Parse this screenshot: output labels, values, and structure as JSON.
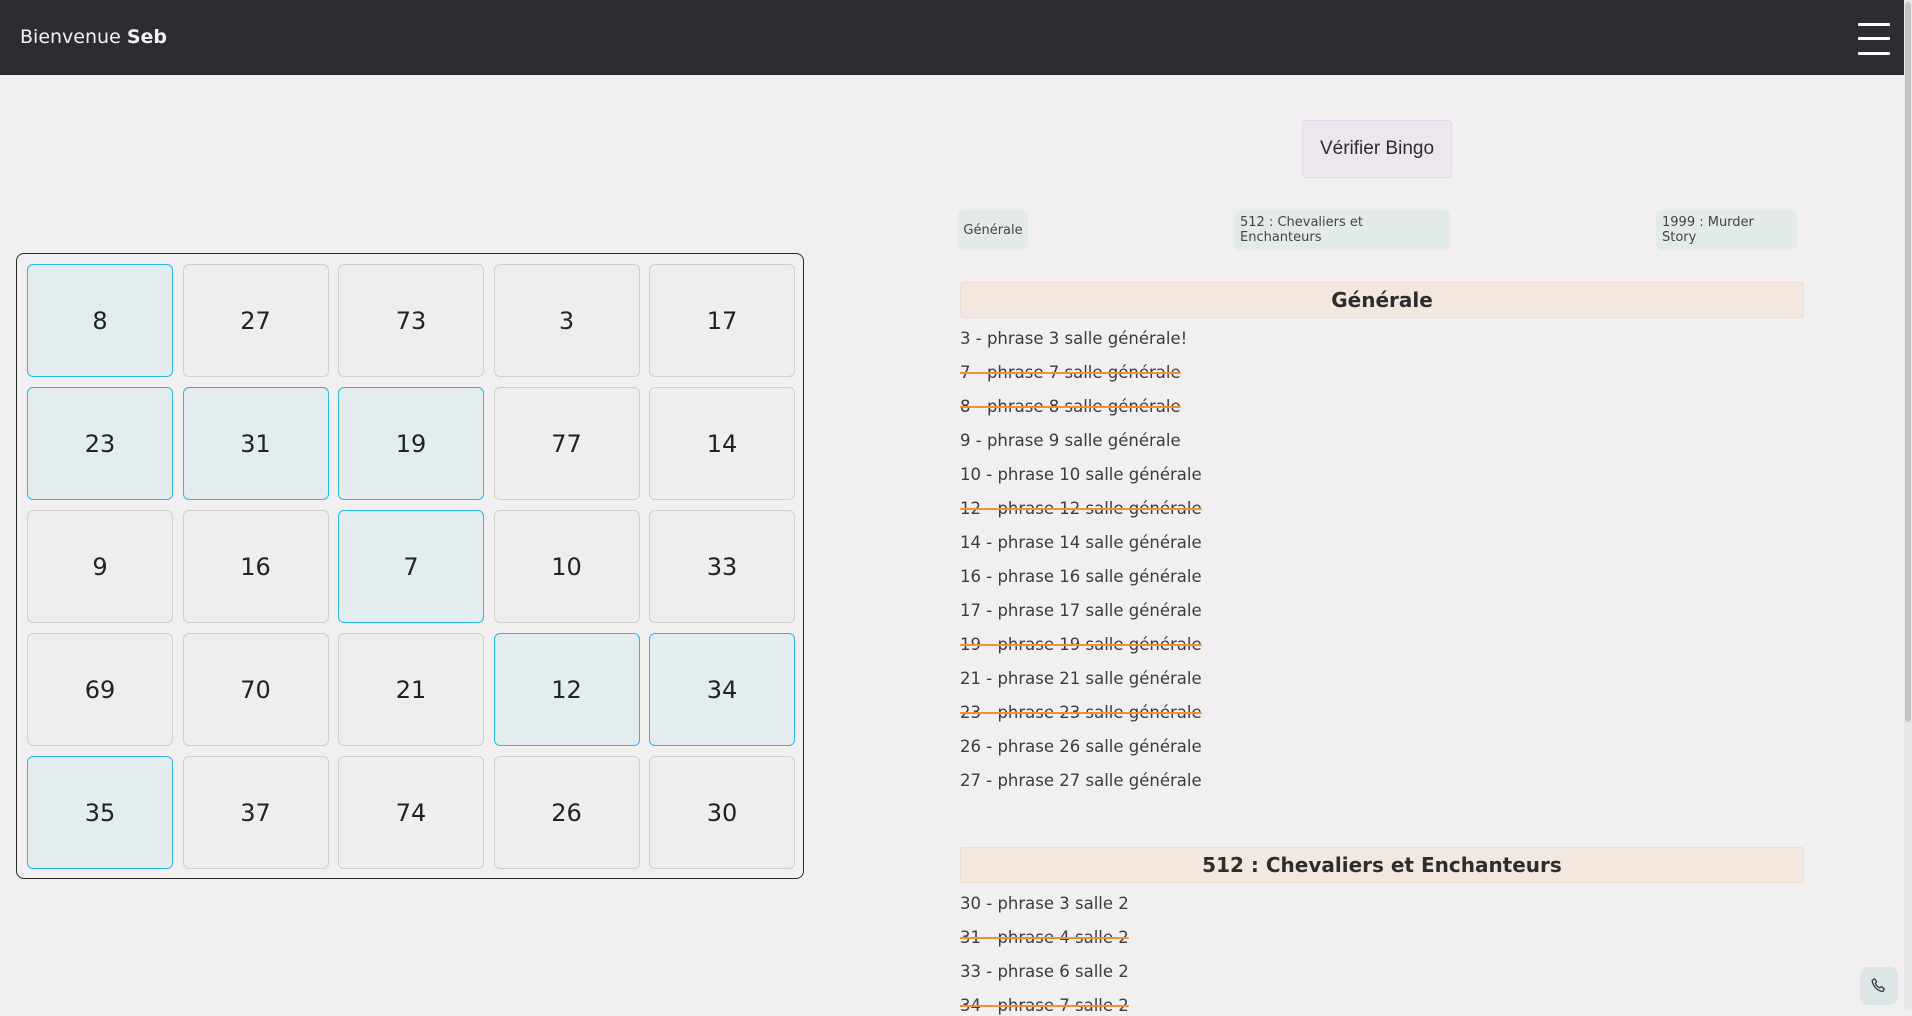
{
  "header": {
    "welcome_prefix": "Bienvenue",
    "user_name": "Seb",
    "menu_icon": "hamburger-menu-icon"
  },
  "grid": {
    "rows": [
      [
        {
          "n": "8",
          "checked": true
        },
        {
          "n": "27",
          "checked": false
        },
        {
          "n": "73",
          "checked": false
        },
        {
          "n": "3",
          "checked": false
        },
        {
          "n": "17",
          "checked": false
        }
      ],
      [
        {
          "n": "23",
          "checked": true
        },
        {
          "n": "31",
          "checked": true
        },
        {
          "n": "19",
          "checked": true
        },
        {
          "n": "77",
          "checked": false
        },
        {
          "n": "14",
          "checked": false
        }
      ],
      [
        {
          "n": "9",
          "checked": false
        },
        {
          "n": "16",
          "checked": false
        },
        {
          "n": "7",
          "checked": true
        },
        {
          "n": "10",
          "checked": false
        },
        {
          "n": "33",
          "checked": false
        }
      ],
      [
        {
          "n": "69",
          "checked": false
        },
        {
          "n": "70",
          "checked": false
        },
        {
          "n": "21",
          "checked": false
        },
        {
          "n": "12",
          "checked": true
        },
        {
          "n": "34",
          "checked": true
        }
      ],
      [
        {
          "n": "35",
          "checked": true
        },
        {
          "n": "37",
          "checked": false
        },
        {
          "n": "74",
          "checked": false
        },
        {
          "n": "26",
          "checked": false
        },
        {
          "n": "30",
          "checked": false
        }
      ]
    ],
    "checked_color": "#2ab8e6"
  },
  "actions": {
    "verify_label": "Vérifier Bingo"
  },
  "tabs": [
    "Générale",
    "512 : Chevaliers et Enchanteurs",
    "1999 : Murder Story"
  ],
  "sections": [
    {
      "title": "Générale",
      "phrases": [
        {
          "text": "3 - phrase 3 salle générale!",
          "struck": false
        },
        {
          "text": "7 - phrase 7 salle générale",
          "struck": true
        },
        {
          "text": "8 - phrase 8 salle générale",
          "struck": true
        },
        {
          "text": "9 - phrase 9 salle générale",
          "struck": false
        },
        {
          "text": "10 - phrase 10 salle générale",
          "struck": false
        },
        {
          "text": "12 - phrase 12 salle générale",
          "struck": true
        },
        {
          "text": "14 - phrase 14 salle générale",
          "struck": false
        },
        {
          "text": "16 - phrase 16 salle générale",
          "struck": false
        },
        {
          "text": "17 - phrase 17 salle générale",
          "struck": false
        },
        {
          "text": "19 - phrase 19 salle générale",
          "struck": true
        },
        {
          "text": "21 - phrase 21 salle générale",
          "struck": false
        },
        {
          "text": "23 - phrase 23 salle générale",
          "struck": true
        },
        {
          "text": "26 - phrase 26 salle générale",
          "struck": false
        },
        {
          "text": "27 - phrase 27 salle générale",
          "struck": false
        }
      ]
    },
    {
      "title": "512 : Chevaliers et Enchanteurs",
      "phrases": [
        {
          "text": "30 - phrase 3 salle 2",
          "struck": false
        },
        {
          "text": "31 - phrase 4 salle 2",
          "struck": true
        },
        {
          "text": "33 - phrase 6 salle 2",
          "struck": false
        },
        {
          "text": "34 - phrase 7 salle 2",
          "struck": true
        }
      ]
    }
  ],
  "strike_color": "#f0913a",
  "call_icon": "phone-icon"
}
